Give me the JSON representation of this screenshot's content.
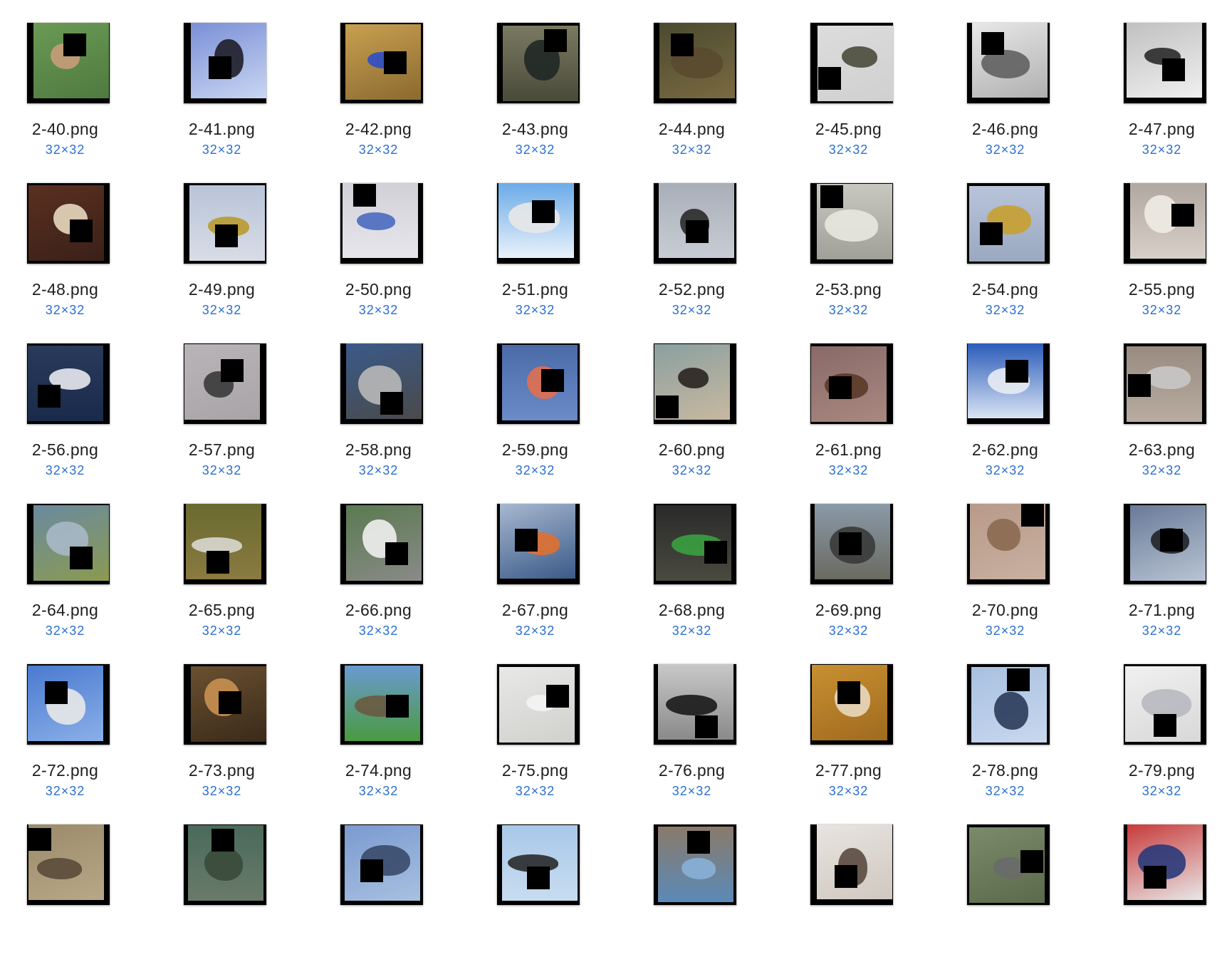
{
  "files": [
    {
      "name": "2-40.png",
      "dims": "32×32",
      "bg": [
        "#6a9a55",
        "#4f7a40"
      ],
      "obj": "#c89c7a"
    },
    {
      "name": "2-41.png",
      "dims": "32×32",
      "bg": [
        "#7b8fd6",
        "#c8d6f2"
      ],
      "obj": "#1e1e2a"
    },
    {
      "name": "2-42.png",
      "dims": "32×32",
      "bg": [
        "#c8a050",
        "#8a6a30"
      ],
      "obj": "#2c4ec8"
    },
    {
      "name": "2-43.png",
      "dims": "32×32",
      "bg": [
        "#7a7a62",
        "#4a4a3a"
      ],
      "obj": "#202826"
    },
    {
      "name": "2-44.png",
      "dims": "32×32",
      "bg": [
        "#4a4a30",
        "#7a6a40"
      ],
      "obj": "#5a4a30"
    },
    {
      "name": "2-45.png",
      "dims": "32×32",
      "bg": [
        "#dcdcdc",
        "#d0d0d0"
      ],
      "obj": "#4a4a3c"
    },
    {
      "name": "2-46.png",
      "dims": "32×32",
      "bg": [
        "#e8e8e8",
        "#b0b0b0"
      ],
      "obj": "#606060"
    },
    {
      "name": "2-47.png",
      "dims": "32×32",
      "bg": [
        "#c0c0c0",
        "#f0f0f0"
      ],
      "obj": "#2a2a2a"
    },
    {
      "name": "2-48.png",
      "dims": "32×32",
      "bg": [
        "#5a3020",
        "#3a2018"
      ],
      "obj": "#e8d8c0"
    },
    {
      "name": "2-49.png",
      "dims": "32×32",
      "bg": [
        "#b8c4d8",
        "#d8dce6"
      ],
      "obj": "#b89a30"
    },
    {
      "name": "2-50.png",
      "dims": "32×32",
      "bg": [
        "#d0d0d6",
        "#e6e6ec"
      ],
      "obj": "#4a6ac0"
    },
    {
      "name": "2-51.png",
      "dims": "32×32",
      "bg": [
        "#6aaae8",
        "#e8f2fa"
      ],
      "obj": "#e8e8e8"
    },
    {
      "name": "2-52.png",
      "dims": "32×32",
      "bg": [
        "#a8aeb8",
        "#c8ccd4"
      ],
      "obj": "#2a2a2a"
    },
    {
      "name": "2-53.png",
      "dims": "32×32",
      "bg": [
        "#c8c8c0",
        "#a0a098"
      ],
      "obj": "#e8e8e0"
    },
    {
      "name": "2-54.png",
      "dims": "32×32",
      "bg": [
        "#b8c4da",
        "#9aa8c0"
      ],
      "obj": "#c8a030"
    },
    {
      "name": "2-55.png",
      "dims": "32×32",
      "bg": [
        "#b0a8a0",
        "#d8d0c8"
      ],
      "obj": "#f0ece4"
    },
    {
      "name": "2-56.png",
      "dims": "32×32",
      "bg": [
        "#2a3a5a",
        "#1a2a4a"
      ],
      "obj": "#e8e8f0"
    },
    {
      "name": "2-57.png",
      "dims": "32×32",
      "bg": [
        "#b8b4b8",
        "#a8a4a8"
      ],
      "obj": "#3a3a3a"
    },
    {
      "name": "2-58.png",
      "dims": "32×32",
      "bg": [
        "#3a5a8a",
        "#4a4a4a"
      ],
      "obj": "#b8b8b8"
    },
    {
      "name": "2-59.png",
      "dims": "32×32",
      "bg": [
        "#4a6aa8",
        "#6a8ac8"
      ],
      "obj": "#e07050"
    },
    {
      "name": "2-60.png",
      "dims": "32×32",
      "bg": [
        "#8aa0a0",
        "#c8b8a0"
      ],
      "obj": "#2a2420"
    },
    {
      "name": "2-61.png",
      "dims": "32×32",
      "bg": [
        "#8a6a68",
        "#a88880"
      ],
      "obj": "#5a3a28"
    },
    {
      "name": "2-62.png",
      "dims": "32×32",
      "bg": [
        "#2a5ab8",
        "#d8e4f4"
      ],
      "obj": "#e8ecf4"
    },
    {
      "name": "2-63.png",
      "dims": "32×32",
      "bg": [
        "#988c80",
        "#b8aca0"
      ],
      "obj": "#c8c8c8"
    },
    {
      "name": "2-64.png",
      "dims": "32×32",
      "bg": [
        "#6a8aa0",
        "#8a9a50"
      ],
      "obj": "#a8b8c8"
    },
    {
      "name": "2-65.png",
      "dims": "32×32",
      "bg": [
        "#6a6a30",
        "#8a7a40"
      ],
      "obj": "#d8d8d0"
    },
    {
      "name": "2-66.png",
      "dims": "32×32",
      "bg": [
        "#5a7a50",
        "#8a8a88"
      ],
      "obj": "#f0f0f0"
    },
    {
      "name": "2-67.png",
      "dims": "32×32",
      "bg": [
        "#a8b8d0",
        "#3a5a88"
      ],
      "obj": "#e07030"
    },
    {
      "name": "2-68.png",
      "dims": "32×32",
      "bg": [
        "#2a2a2a",
        "#4a4a40"
      ],
      "obj": "#3aa040"
    },
    {
      "name": "2-69.png",
      "dims": "32×32",
      "bg": [
        "#8a9aa8",
        "#6a6a60"
      ],
      "obj": "#3a3a3a"
    },
    {
      "name": "2-70.png",
      "dims": "32×32",
      "bg": [
        "#b89a8a",
        "#c8b0a0"
      ],
      "obj": "#8a6a50"
    },
    {
      "name": "2-71.png",
      "dims": "32×32",
      "bg": [
        "#6a7a98",
        "#b8c4d4"
      ],
      "obj": "#202428"
    },
    {
      "name": "2-72.png",
      "dims": "32×32",
      "bg": [
        "#4a7ad0",
        "#8ab0e8"
      ],
      "obj": "#e8e8e8"
    },
    {
      "name": "2-73.png",
      "dims": "32×32",
      "bg": [
        "#6a5030",
        "#3a2a1a"
      ],
      "obj": "#c89050"
    },
    {
      "name": "2-74.png",
      "dims": "32×32",
      "bg": [
        "#6a9ad0",
        "#4a9a40"
      ],
      "obj": "#6a5a40"
    },
    {
      "name": "2-75.png",
      "dims": "32×32",
      "bg": [
        "#e8e8e8",
        "#d0d0cc"
      ],
      "obj": "#f4f4f4"
    },
    {
      "name": "2-76.png",
      "dims": "32×32",
      "bg": [
        "#c8c8c8",
        "#8a8a8a"
      ],
      "obj": "#1a1a1a"
    },
    {
      "name": "2-77.png",
      "dims": "32×32",
      "bg": [
        "#c89030",
        "#a06a20"
      ],
      "obj": "#e8d8c0"
    },
    {
      "name": "2-78.png",
      "dims": "32×32",
      "bg": [
        "#a8c0e0",
        "#c8d8ee"
      ],
      "obj": "#2a3a5a"
    },
    {
      "name": "2-79.png",
      "dims": "32×32",
      "bg": [
        "#f0f0f0",
        "#d8d8d8"
      ],
      "obj": "#b8b8c0"
    },
    {
      "name": "",
      "dims": "",
      "bg": [
        "#9a8a6a",
        "#b8a888"
      ],
      "obj": "#5a4a3a"
    },
    {
      "name": "",
      "dims": "",
      "bg": [
        "#4a6a5a",
        "#6a7a6a"
      ],
      "obj": "#3a4a3a"
    },
    {
      "name": "",
      "dims": "",
      "bg": [
        "#7a9ad0",
        "#a8c0e0"
      ],
      "obj": "#3a4a6a"
    },
    {
      "name": "",
      "dims": "",
      "bg": [
        "#a8c8e8",
        "#c8dcf0"
      ],
      "obj": "#2a2a2a"
    },
    {
      "name": "",
      "dims": "",
      "bg": [
        "#8a7a6a",
        "#5a8ab8"
      ],
      "obj": "#8ab0d8"
    },
    {
      "name": "",
      "dims": "",
      "bg": [
        "#e8e4e0",
        "#d0c8c0"
      ],
      "obj": "#5a4a40"
    },
    {
      "name": "",
      "dims": "",
      "bg": [
        "#7a8a6a",
        "#5a6a4a"
      ],
      "obj": "#6a6a6a"
    },
    {
      "name": "",
      "dims": "",
      "bg": [
        "#c83a3a",
        "#e8e8e8"
      ],
      "obj": "#2a3a7a"
    }
  ]
}
